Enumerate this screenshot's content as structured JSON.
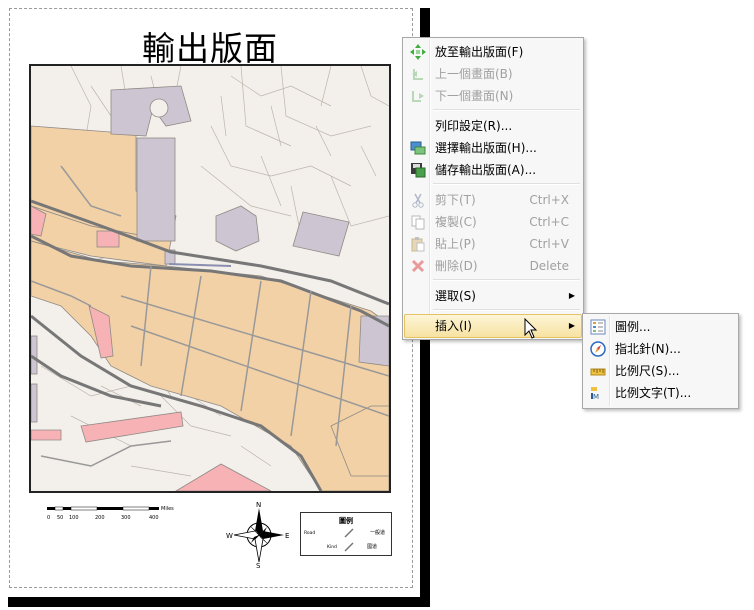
{
  "layout": {
    "title": "輸出版面"
  },
  "scalebar": {
    "ticks": [
      "0",
      "50",
      "100",
      "200",
      "300",
      "400"
    ],
    "unit": "Miles"
  },
  "north_arrow": {
    "n": "N",
    "s": "S",
    "e": "E",
    "w": "W"
  },
  "legend": {
    "title": "圖例",
    "rows": [
      {
        "label": "Road",
        "value": "一般道"
      },
      {
        "label": "Kind",
        "value": "國道"
      }
    ]
  },
  "context_menu": {
    "items": [
      {
        "label": "放至輸出版面(F)",
        "shortcut": "",
        "icon": "zoom-to-layout-icon",
        "disabled": false
      },
      {
        "label": "上一個畫面(B)",
        "shortcut": "",
        "icon": "previous-extent-icon",
        "disabled": true
      },
      {
        "label": "下一個畫面(N)",
        "shortcut": "",
        "icon": "next-extent-icon",
        "disabled": true
      },
      {
        "label": "列印設定(R)...",
        "shortcut": "",
        "icon": "",
        "disabled": false
      },
      {
        "label": "選擇輸出版面(H)...",
        "shortcut": "",
        "icon": "select-layout-icon",
        "disabled": false
      },
      {
        "label": "儲存輸出版面(A)...",
        "shortcut": "",
        "icon": "save-layout-icon",
        "disabled": false
      },
      {
        "label": "剪下(T)",
        "shortcut": "Ctrl+X",
        "icon": "cut-icon",
        "disabled": true
      },
      {
        "label": "複製(C)",
        "shortcut": "Ctrl+C",
        "icon": "copy-icon",
        "disabled": true
      },
      {
        "label": "貼上(P)",
        "shortcut": "Ctrl+V",
        "icon": "paste-icon",
        "disabled": true
      },
      {
        "label": "刪除(D)",
        "shortcut": "Delete",
        "icon": "delete-icon",
        "disabled": true
      },
      {
        "label": "選取(S)",
        "shortcut": "",
        "icon": "",
        "disabled": false
      },
      {
        "label": "插入(I)",
        "shortcut": "",
        "icon": "",
        "disabled": false
      }
    ]
  },
  "submenu": {
    "items": [
      {
        "label": "圖例...",
        "icon": "legend-icon"
      },
      {
        "label": "指北針(N)...",
        "icon": "north-arrow-icon"
      },
      {
        "label": "比例尺(S)...",
        "icon": "scale-bar-icon"
      },
      {
        "label": "比例文字(T)...",
        "icon": "scale-text-icon"
      }
    ]
  },
  "colors": {
    "land_tan": "#f2d1a6",
    "public_gray": "#cdc6d2",
    "commercial_pink": "#f7b2b6",
    "road_gray": "#7a7a7a",
    "background": "#f3efea",
    "menu_highlight": "#f7e2a0"
  }
}
